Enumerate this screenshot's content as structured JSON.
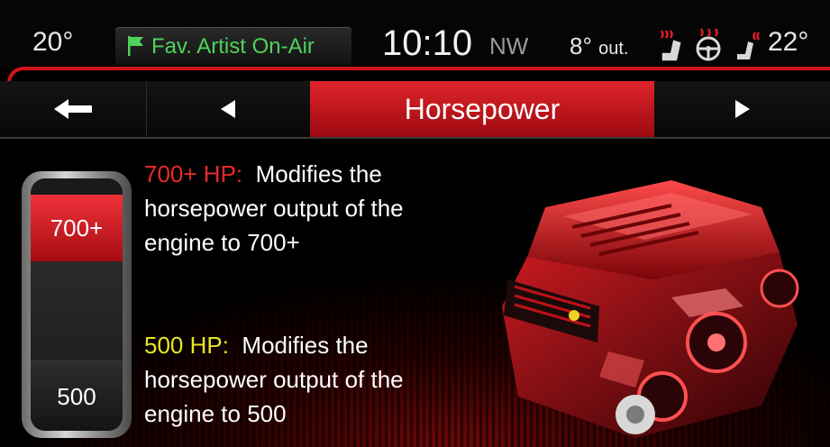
{
  "status": {
    "temp_left": "20°",
    "radio": "Fav. Artist On-Air",
    "clock": "10:10",
    "compass": "NW",
    "outside_temp": "8°",
    "outside_label": "out.",
    "temp_right": "22°"
  },
  "tabs": {
    "title": "Horsepower"
  },
  "selector": {
    "options": [
      "700+",
      "500"
    ],
    "selected": "700+"
  },
  "descriptions": [
    {
      "label": "700+ HP:",
      "lines": [
        "Modifies the",
        "horsepower output of the",
        "engine to 700+"
      ]
    },
    {
      "label": "500 HP:",
      "lines": [
        "Modifies the",
        "horsepower output of the",
        "engine to 500"
      ]
    }
  ],
  "colors": {
    "accent_red": "#d1121c",
    "radio_green": "#4fd25a",
    "label_red": "#e82a2a",
    "label_yellow": "#e9e526"
  },
  "icons": [
    "flag-icon",
    "seat-heat-icon",
    "steering-wheel-heat-icon",
    "seat-vent-icon",
    "back-arrow-icon",
    "left-triangle-icon",
    "right-triangle-icon"
  ]
}
